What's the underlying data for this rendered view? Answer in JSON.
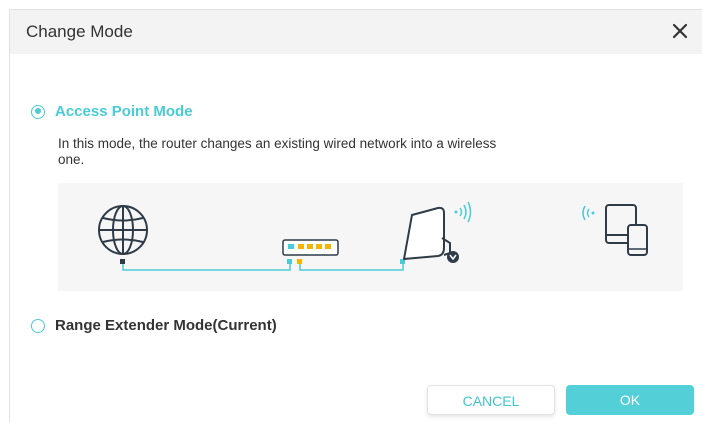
{
  "dialog": {
    "title": "Change Mode",
    "close_icon": "close-icon"
  },
  "options": {
    "access_point": {
      "label": "Access Point Mode",
      "selected": true,
      "description": "In this mode, the router changes an existing wired network into a wireless one."
    },
    "range_extender": {
      "label": "Range Extender Mode(Current)",
      "selected": false
    }
  },
  "diagram": {
    "icons": [
      "globe-icon",
      "switch-icon",
      "extender-icon",
      "wifi-signal-icon",
      "tablet-icon",
      "phone-icon"
    ]
  },
  "buttons": {
    "cancel": "CANCEL",
    "ok": "OK"
  },
  "colors": {
    "accent": "#4acbd6",
    "ok_button": "#53cfd8",
    "cable": "#4acbd6",
    "port_yellow": "#f5b400",
    "icon_dark": "#2f3b48"
  }
}
